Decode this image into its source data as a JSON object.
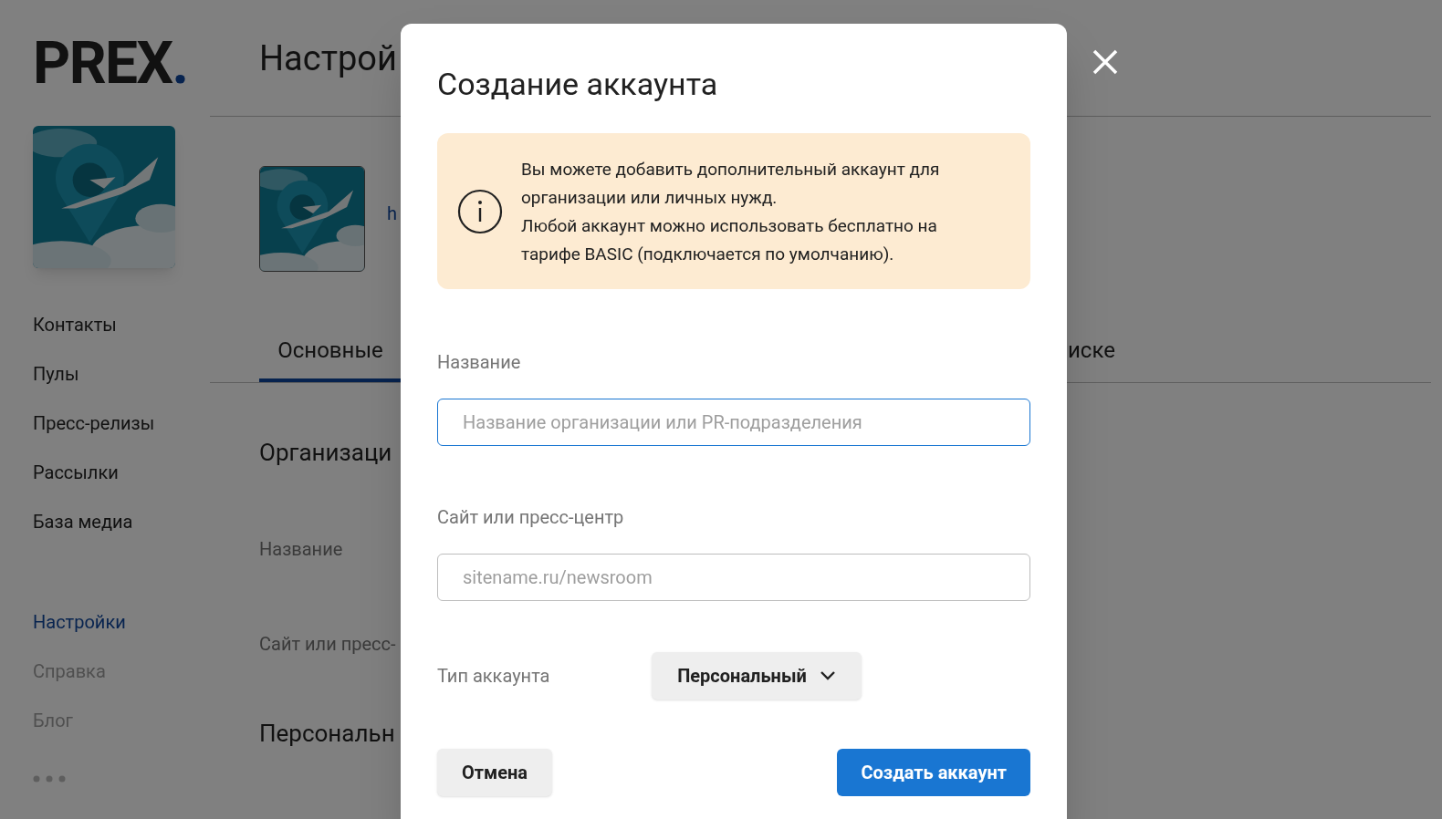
{
  "logo": {
    "text": "PREX",
    "dot": "."
  },
  "sidebar": {
    "items": [
      {
        "label": "Контакты",
        "kind": "main",
        "selected": false
      },
      {
        "label": "Пулы",
        "kind": "main",
        "selected": false
      },
      {
        "label": "Пресс-релизы",
        "kind": "main",
        "selected": false
      },
      {
        "label": "Рассылки",
        "kind": "main",
        "selected": false
      },
      {
        "label": "База медиа",
        "kind": "main",
        "selected": false
      },
      {
        "label": "Настройки",
        "kind": "secondary",
        "selected": true
      },
      {
        "label": "Справка",
        "kind": "secondary",
        "selected": false
      },
      {
        "label": "Блог",
        "kind": "secondary",
        "selected": false
      }
    ]
  },
  "page": {
    "title": "Настрой",
    "account_link": "h",
    "tabs": [
      {
        "label": "Основные",
        "selected": true
      },
      {
        "label": "иске",
        "selected": false
      }
    ],
    "sections": [
      {
        "kind": "heading",
        "text": "Организаци"
      },
      {
        "kind": "label",
        "text": "Название"
      },
      {
        "kind": "label",
        "text": "Сайт или пресс-"
      },
      {
        "kind": "heading",
        "text": "Персональн"
      }
    ]
  },
  "dialog": {
    "title": "Создание аккаунта",
    "info": [
      "Вы можете добавить дополнительный аккаунт для организации или личных нужд.",
      "Любой аккаунт можно использовать бесплатно на тарифе BASIC (подключается по умолчанию)."
    ],
    "fields": [
      {
        "label": "Название",
        "placeholder": "Название организации или PR-подразделения",
        "focused": true
      },
      {
        "label": "Сайт или пресс-центр",
        "placeholder": "sitename.ru/newsroom",
        "focused": false
      }
    ],
    "account_type": {
      "label": "Тип аккаунта",
      "value": "Персональный"
    },
    "buttons": [
      {
        "label": "Отмена",
        "kind": "secondary"
      },
      {
        "label": "Создать аккаунт",
        "kind": "primary"
      }
    ]
  }
}
